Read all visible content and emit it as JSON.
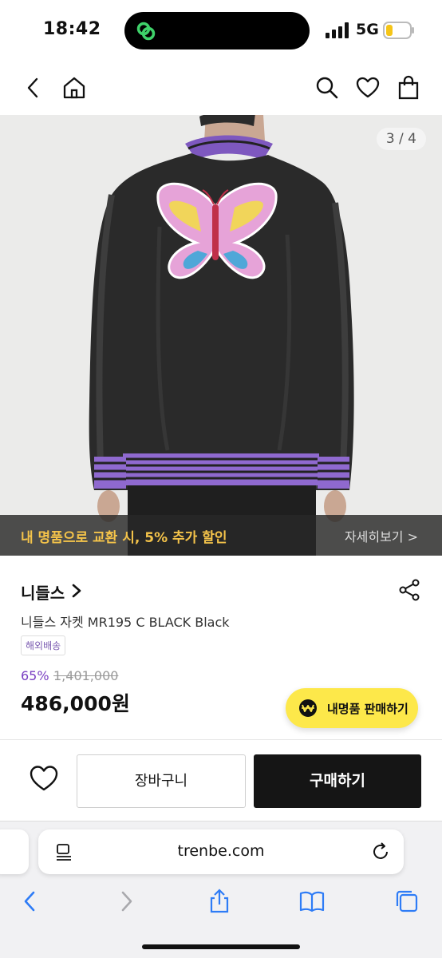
{
  "status_bar": {
    "time": "18:42",
    "network": "5G",
    "battery_color": "#f5c518"
  },
  "nav": {
    "back_icon": "chevron-left-icon",
    "home_icon": "home-icon",
    "search_icon": "search-icon",
    "wishlist_icon": "heart-icon",
    "bag_icon": "shopping-bag-icon"
  },
  "hero": {
    "page_indicator": "3 / 4",
    "promo_text": "내 명품으로 교환 시, 5% 추가 할인",
    "promo_link": "자세히보기 >"
  },
  "product": {
    "brand": "니들스",
    "name": "니들스 자켓 MR195 C BLACK Black",
    "shipping_tag": "해외배송",
    "discount": "65%",
    "original_price": "1,401,000",
    "price": "486,000원"
  },
  "sell_button": {
    "label": "내명품 판매하기",
    "color": "#fde84a"
  },
  "actions": {
    "cart_label": "장바구니",
    "buy_label": "구매하기"
  },
  "browser": {
    "url": "trenbe.com"
  }
}
